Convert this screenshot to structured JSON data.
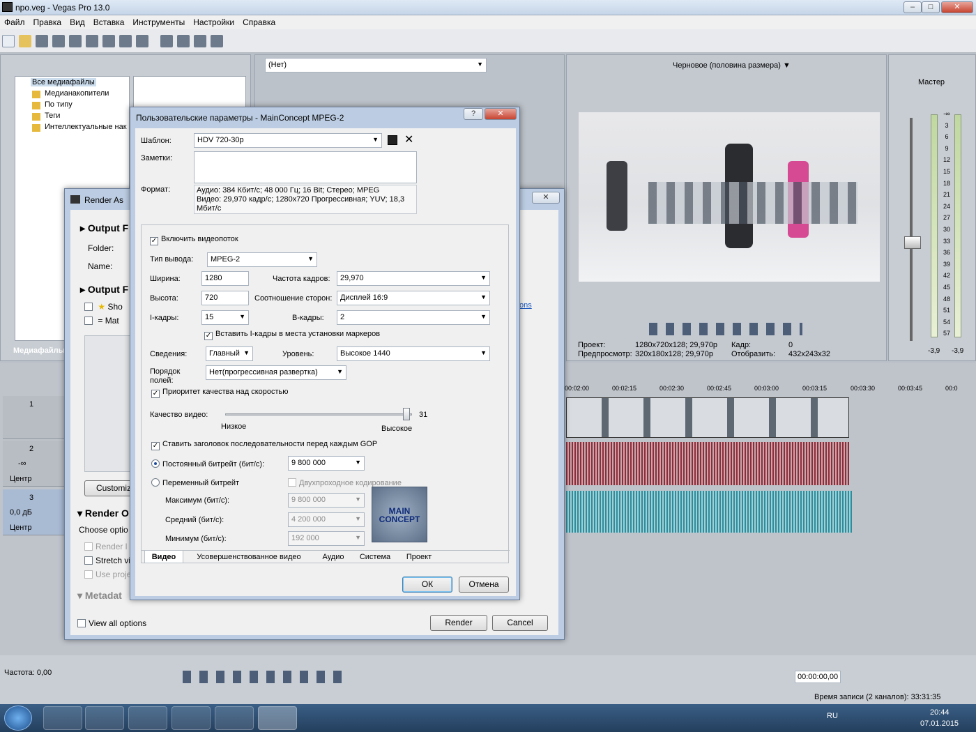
{
  "app": {
    "title": "npo.veg - Vegas Pro 13.0"
  },
  "menu": [
    "Файл",
    "Правка",
    "Вид",
    "Вставка",
    "Инструменты",
    "Настройки",
    "Справка"
  ],
  "explorer": {
    "items": [
      "Все медиафайлы",
      "Медианакопители",
      "По типу",
      "Теги",
      "Интеллектуальные нак"
    ],
    "tab": "Медиафайлы"
  },
  "trimmer": {
    "combo": "(Нет)"
  },
  "preview": {
    "quality": "Черновое (половина размера)",
    "project_label": "Проект:",
    "project_value": "1280x720x128; 29,970p",
    "preview_label": "Предпросмотр:",
    "preview_value": "320x180x128; 29,970p",
    "frame_label": "Кадр:",
    "frame_value": "0",
    "display_label": "Отобразить:",
    "display_value": "432x243x32"
  },
  "master": {
    "label": "Мастер",
    "scale": [
      "-∞",
      "3",
      "6",
      "9",
      "12",
      "15",
      "18",
      "21",
      "24",
      "27",
      "30",
      "33",
      "36",
      "39",
      "42",
      "45",
      "48",
      "51",
      "54",
      "57"
    ],
    "left": "-3,9",
    "right": "-3,9"
  },
  "timeline": {
    "ticks": [
      "00:02:00",
      "00:02:15",
      "00:02:30",
      "00:02:45",
      "00:03:00",
      "00:03:15",
      "00:03:30",
      "00:03:45",
      "00:0"
    ],
    "tracks": [
      {
        "num": "1"
      },
      {
        "num": "2",
        "vol": "-∞",
        "pan": "Центр"
      },
      {
        "num": "3",
        "vol": "0,0 дБ",
        "pan": "Центр"
      }
    ]
  },
  "bottom": {
    "rate": "Частота: 0,00",
    "timecode": "00:00:00,00",
    "record": "Время записи (2 каналов): 33:31:35"
  },
  "render_as": {
    "title": "Render As",
    "output_format": "Output F",
    "folder": "Folder:",
    "name": "Name:",
    "output_files": "Output F",
    "show": "Sho",
    "match": "Mat",
    "customize": "Customiz",
    "render_options": "Render O",
    "choose": "Choose optio",
    "render_loop": "Render l",
    "stretch": "Stretch vi",
    "use_proj": "Use proje",
    "metadata": "Metadat",
    "view_all": "View all options",
    "render_btn": "Render",
    "cancel_btn": "Cancel",
    "link": "ons"
  },
  "dialog": {
    "title": "Пользовательские параметры - MainConcept MPEG-2",
    "template_label": "Шаблон:",
    "template_value": "HDV 720-30p",
    "notes_label": "Заметки:",
    "format_label": "Формат:",
    "format_line1": "Аудио: 384 Кбит/с; 48 000 Гц; 16 Bit; Стерео; MPEG",
    "format_line2": "Видео: 29,970 кадр/с; 1280x720 Прогрессивная; YUV; 18,3",
    "format_line3": "Мбит/с",
    "include_video": "Включить видеопоток",
    "output_type_label": "Тип вывода:",
    "output_type": "MPEG-2",
    "width_label": "Ширина:",
    "width": "1280",
    "height_label": "Высота:",
    "height": "720",
    "fps_label": "Частота кадров:",
    "fps": "29,970",
    "aspect_label": "Соотношение сторон:",
    "aspect": "Дисплей 16:9",
    "iframes_label": "I-кадры:",
    "iframes": "15",
    "bframes_label": "B-кадры:",
    "bframes": "2",
    "insert_iframes": "Вставить I-кадры в места установки маркеров",
    "profile_label": "Сведения:",
    "profile": "Главный",
    "level_label": "Уровень:",
    "level": "Высокое 1440",
    "field_order_label1": "Порядок",
    "field_order_label2": "полей:",
    "field_order": "Нет(прогрессивная развертка)",
    "quality_priority": "Приоритет качества над скоростью",
    "video_quality_label": "Качество видео:",
    "quality_value": "31",
    "quality_fraction": 0.97,
    "low": "Низкое",
    "high": "Высокое",
    "gop_header": "Ставить заголовок последовательности перед каждым GOP",
    "cbr_label": "Постоянный битрейт (бит/с):",
    "cbr": "9 800 000",
    "vbr_label": "Переменный битрейт",
    "two_pass": "Двухпроходное кодирование",
    "max_label": "Максимум (бит/с):",
    "max": "9 800 000",
    "avg_label": "Средний (бит/с):",
    "avg": "4 200 000",
    "min_label": "Минимум (бит/с):",
    "min": "192 000",
    "logo": "MAIN CONCEPT",
    "tabs": [
      "Видео",
      "Усовершенствованное видео",
      "Аудио",
      "Система",
      "Проект"
    ],
    "ok": "ОК",
    "cancel": "Отмена"
  },
  "tray": {
    "lang": "RU",
    "time": "20:44",
    "date": "07.01.2015"
  }
}
